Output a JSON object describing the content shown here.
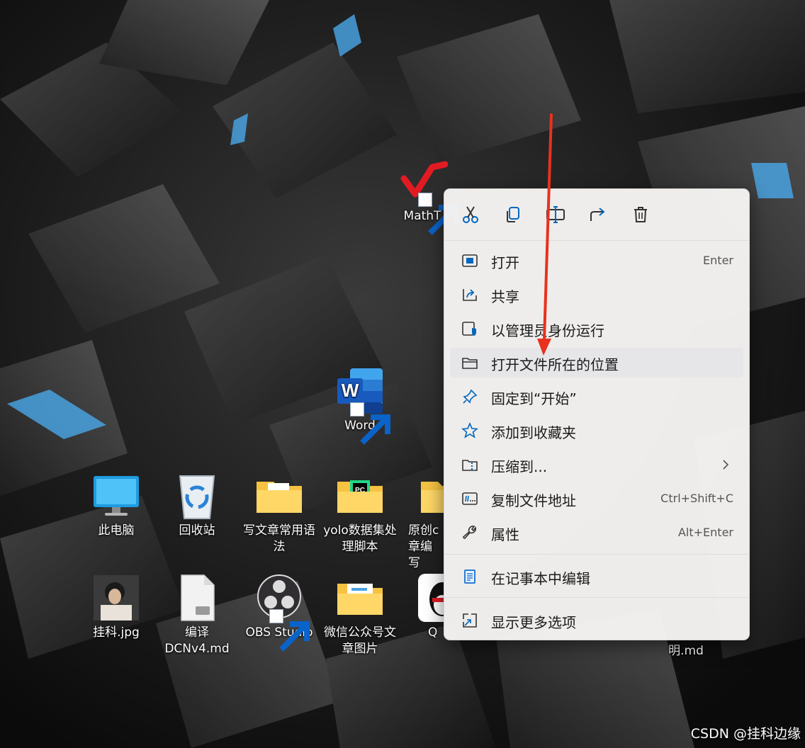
{
  "desktop": {
    "icons": [
      {
        "label": "MathT"
      },
      {
        "label": "Word"
      },
      {
        "label": "此电脑"
      },
      {
        "label": "回收站"
      },
      {
        "label": "写文章常用语法"
      },
      {
        "label": "yolo数据集处理脚本"
      },
      {
        "label": "原创c"
      },
      {
        "label": "章编写"
      },
      {
        "label": "挂科.jpg"
      },
      {
        "label": "编译DCNv4.md"
      },
      {
        "label": "OBS Studio"
      },
      {
        "label": "微信公众号文章图片"
      },
      {
        "label": "Q"
      },
      {
        "label": "明.md"
      }
    ]
  },
  "context_menu": {
    "quick_actions": [
      {
        "icon": "cut-icon"
      },
      {
        "icon": "copy-icon"
      },
      {
        "icon": "rename-icon"
      },
      {
        "icon": "share-icon"
      },
      {
        "icon": "delete-icon"
      }
    ],
    "items": [
      {
        "label": "打开",
        "shortcut": "Enter",
        "icon": "open-icon"
      },
      {
        "label": "共享",
        "shortcut": "",
        "icon": "share-icon"
      },
      {
        "label": "以管理员身份运行",
        "shortcut": "",
        "icon": "admin-shield-icon"
      },
      {
        "label": "打开文件所在的位置",
        "shortcut": "",
        "icon": "folder-icon"
      },
      {
        "label": "固定到“开始”",
        "shortcut": "",
        "icon": "pin-icon"
      },
      {
        "label": "添加到收藏夹",
        "shortcut": "",
        "icon": "star-icon"
      },
      {
        "label": "压缩到...",
        "shortcut": "",
        "icon": "zip-icon"
      },
      {
        "label": "复制文件地址",
        "shortcut": "Ctrl+Shift+C",
        "icon": "copy-path-icon"
      },
      {
        "label": "属性",
        "shortcut": "Alt+Enter",
        "icon": "wrench-icon"
      },
      {
        "label": "在记事本中编辑",
        "shortcut": "",
        "icon": "notepad-icon"
      },
      {
        "label": "显示更多选项",
        "shortcut": "",
        "icon": "more-options-icon"
      }
    ]
  },
  "watermark": "CSDN @挂科边缘",
  "colors": {
    "accent": "#0067c0",
    "annotation_arrow": "#e8321e",
    "menu_bg": "#f6f4f2"
  }
}
